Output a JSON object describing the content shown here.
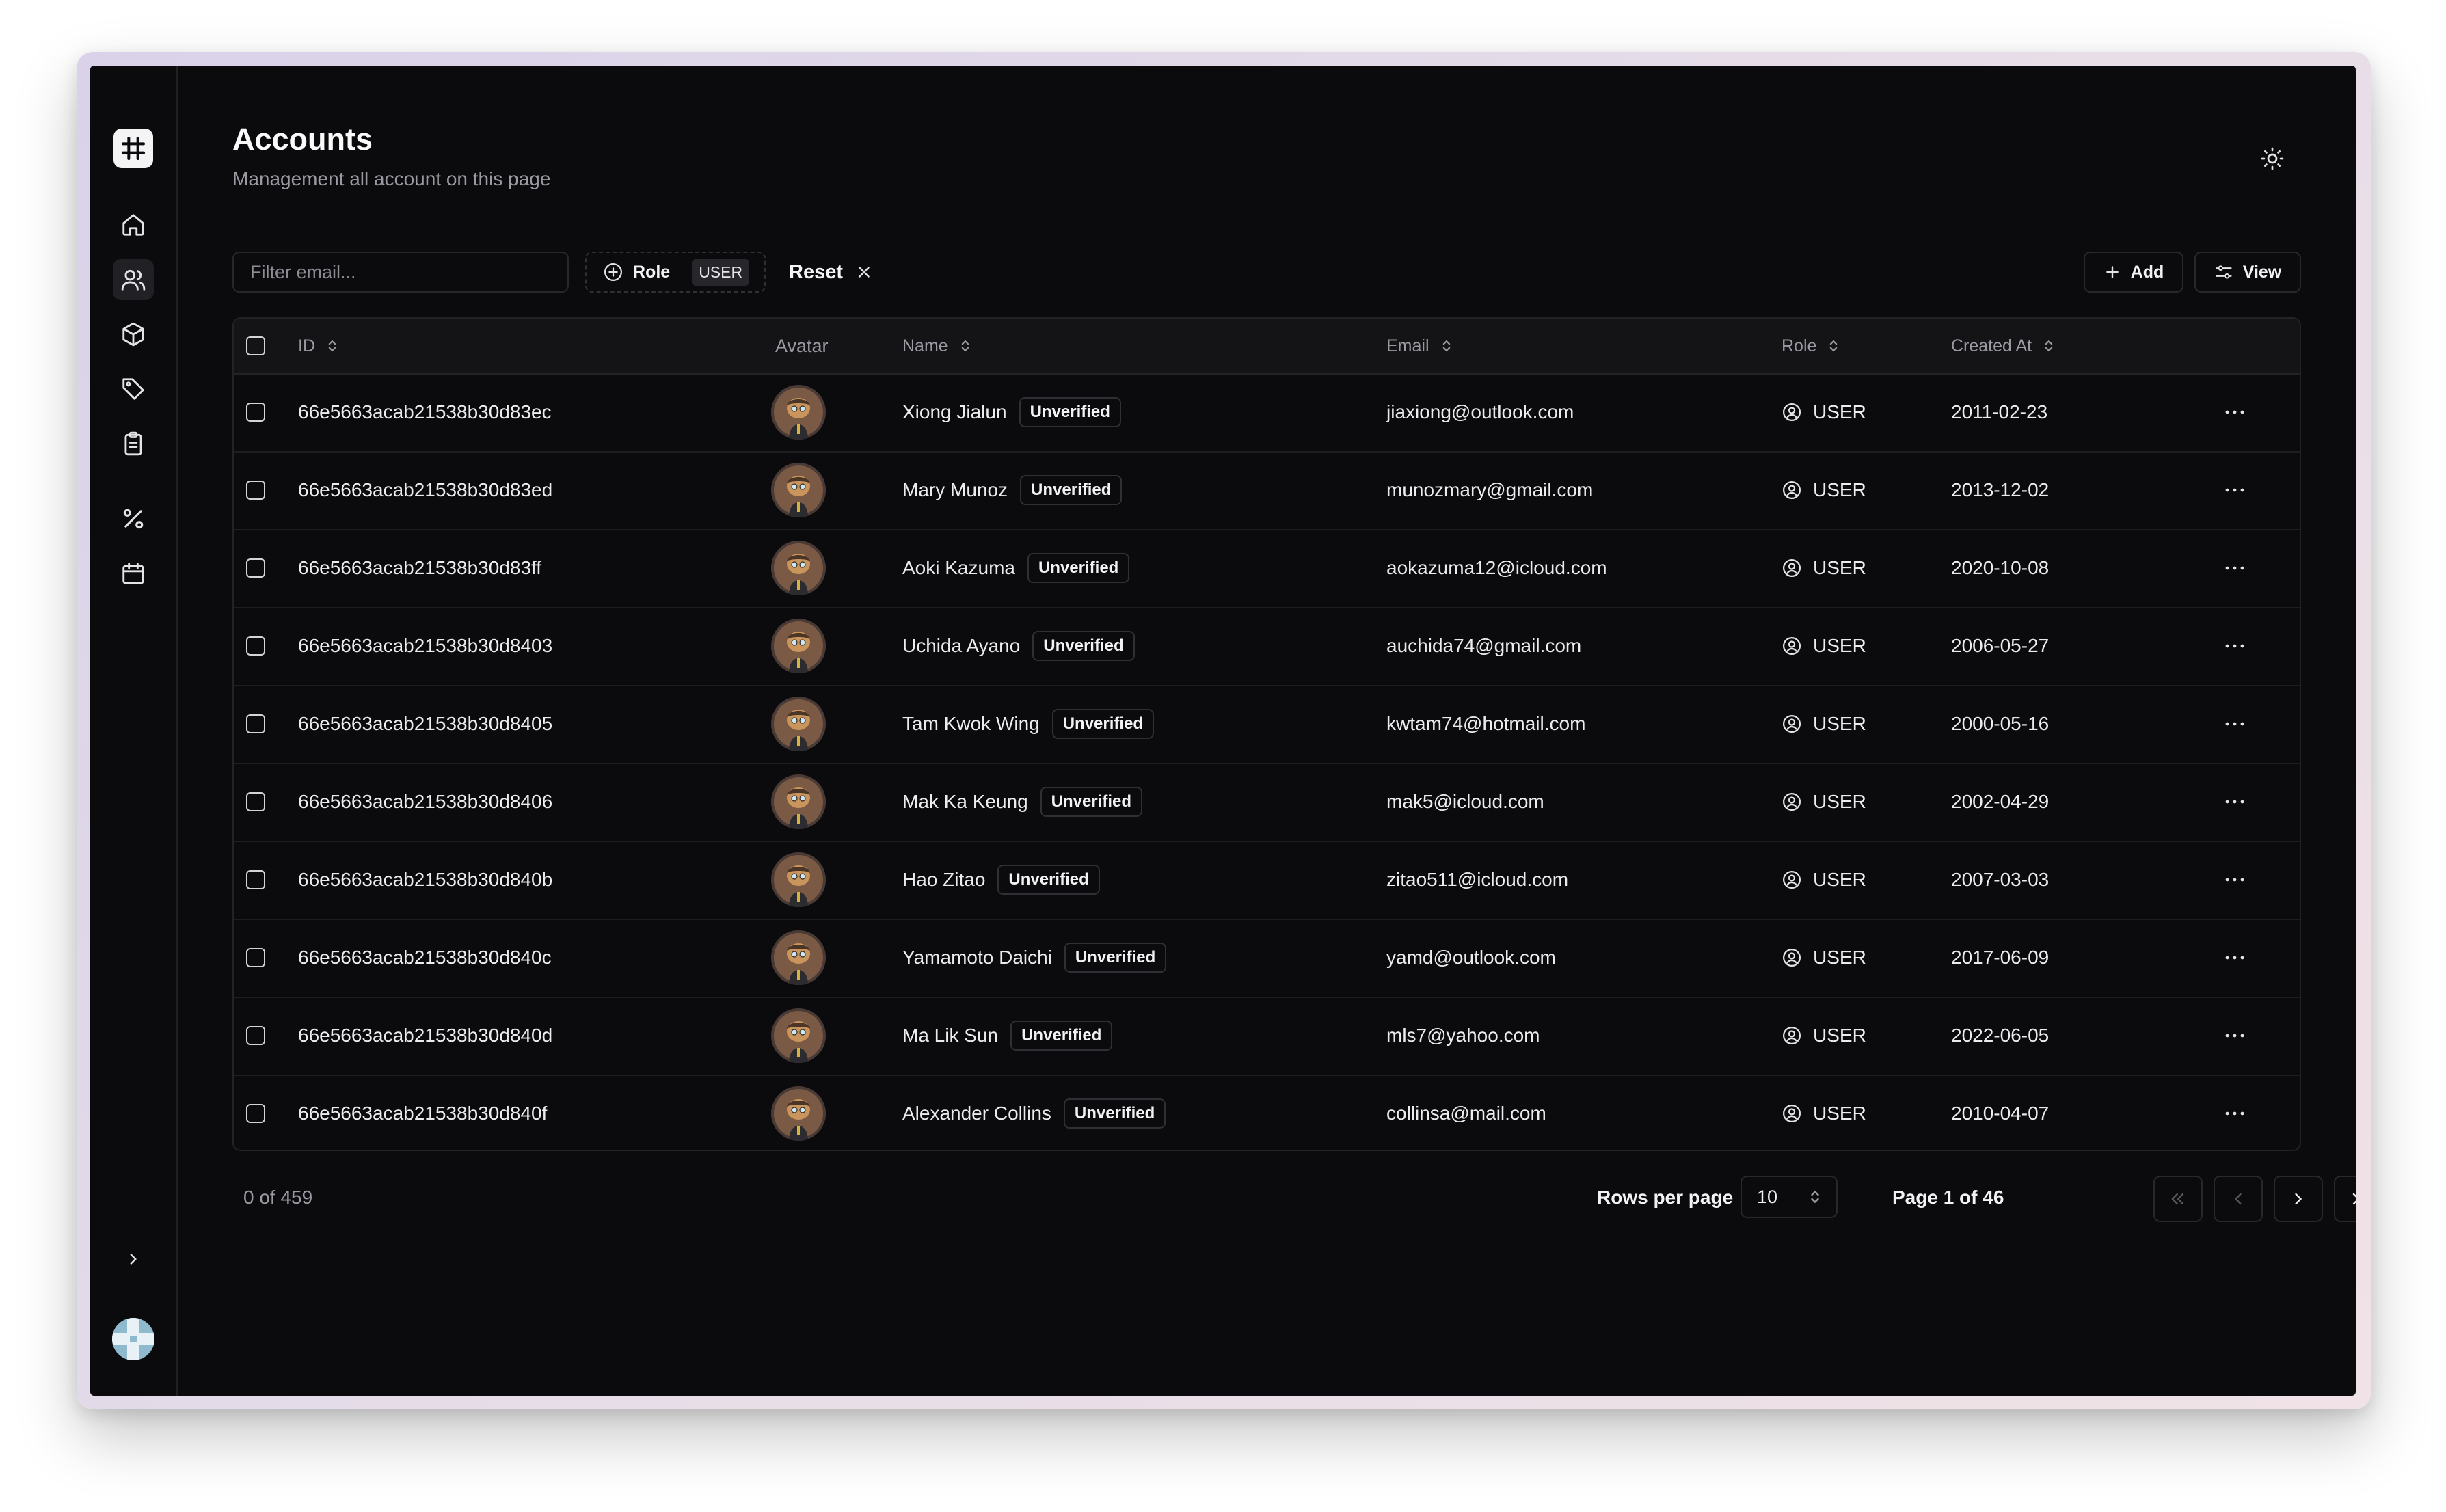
{
  "header": {
    "title": "Accounts",
    "subtitle": "Management all account on this page"
  },
  "sidebar": {
    "items": [
      {
        "name": "home",
        "icon": "home-icon",
        "active": false
      },
      {
        "name": "accounts",
        "icon": "users-icon",
        "active": true
      },
      {
        "name": "products",
        "icon": "box-icon",
        "active": false
      },
      {
        "name": "tags",
        "icon": "tag-icon",
        "active": false
      },
      {
        "name": "orders",
        "icon": "clipboard-icon",
        "active": false
      },
      {
        "name": "discounts",
        "icon": "percent-icon",
        "active": false
      },
      {
        "name": "calendar",
        "icon": "calendar-icon",
        "active": false
      }
    ]
  },
  "toolbar": {
    "filter_placeholder": "Filter email...",
    "role_filter_label": "Role",
    "role_filter_value": "USER",
    "reset_label": "Reset",
    "add_label": "Add",
    "view_label": "View"
  },
  "table": {
    "columns": {
      "id": "ID",
      "avatar": "Avatar",
      "name": "Name",
      "email": "Email",
      "role": "Role",
      "created_at": "Created At"
    },
    "rows": [
      {
        "id": "66e5663acab21538b30d83ec",
        "name": "Xiong Jialun",
        "status": "Unverified",
        "email": "jiaxiong@outlook.com",
        "role": "USER",
        "created_at": "2011-02-23"
      },
      {
        "id": "66e5663acab21538b30d83ed",
        "name": "Mary Munoz",
        "status": "Unverified",
        "email": "munozmary@gmail.com",
        "role": "USER",
        "created_at": "2013-12-02"
      },
      {
        "id": "66e5663acab21538b30d83ff",
        "name": "Aoki Kazuma",
        "status": "Unverified",
        "email": "aokazuma12@icloud.com",
        "role": "USER",
        "created_at": "2020-10-08"
      },
      {
        "id": "66e5663acab21538b30d8403",
        "name": "Uchida Ayano",
        "status": "Unverified",
        "email": "auchida74@gmail.com",
        "role": "USER",
        "created_at": "2006-05-27"
      },
      {
        "id": "66e5663acab21538b30d8405",
        "name": "Tam Kwok Wing",
        "status": "Unverified",
        "email": "kwtam74@hotmail.com",
        "role": "USER",
        "created_at": "2000-05-16"
      },
      {
        "id": "66e5663acab21538b30d8406",
        "name": "Mak Ka Keung",
        "status": "Unverified",
        "email": "mak5@icloud.com",
        "role": "USER",
        "created_at": "2002-04-29"
      },
      {
        "id": "66e5663acab21538b30d840b",
        "name": "Hao Zitao",
        "status": "Unverified",
        "email": "zitao511@icloud.com",
        "role": "USER",
        "created_at": "2007-03-03"
      },
      {
        "id": "66e5663acab21538b30d840c",
        "name": "Yamamoto Daichi",
        "status": "Unverified",
        "email": "yamd@outlook.com",
        "role": "USER",
        "created_at": "2017-06-09"
      },
      {
        "id": "66e5663acab21538b30d840d",
        "name": "Ma Lik Sun",
        "status": "Unverified",
        "email": "mls7@yahoo.com",
        "role": "USER",
        "created_at": "2022-06-05"
      },
      {
        "id": "66e5663acab21538b30d840f",
        "name": "Alexander Collins",
        "status": "Unverified",
        "email": "collinsa@mail.com",
        "role": "USER",
        "created_at": "2010-04-07"
      }
    ]
  },
  "footer": {
    "selection": "0 of 459",
    "rows_per_page_label": "Rows per page",
    "rows_per_page_value": "10",
    "page_label": "Page 1 of 46"
  },
  "colors": {
    "background": "#0b0b0d",
    "border": "#27272c",
    "muted_text": "#9a9aa3",
    "text": "#f2f2f4"
  }
}
